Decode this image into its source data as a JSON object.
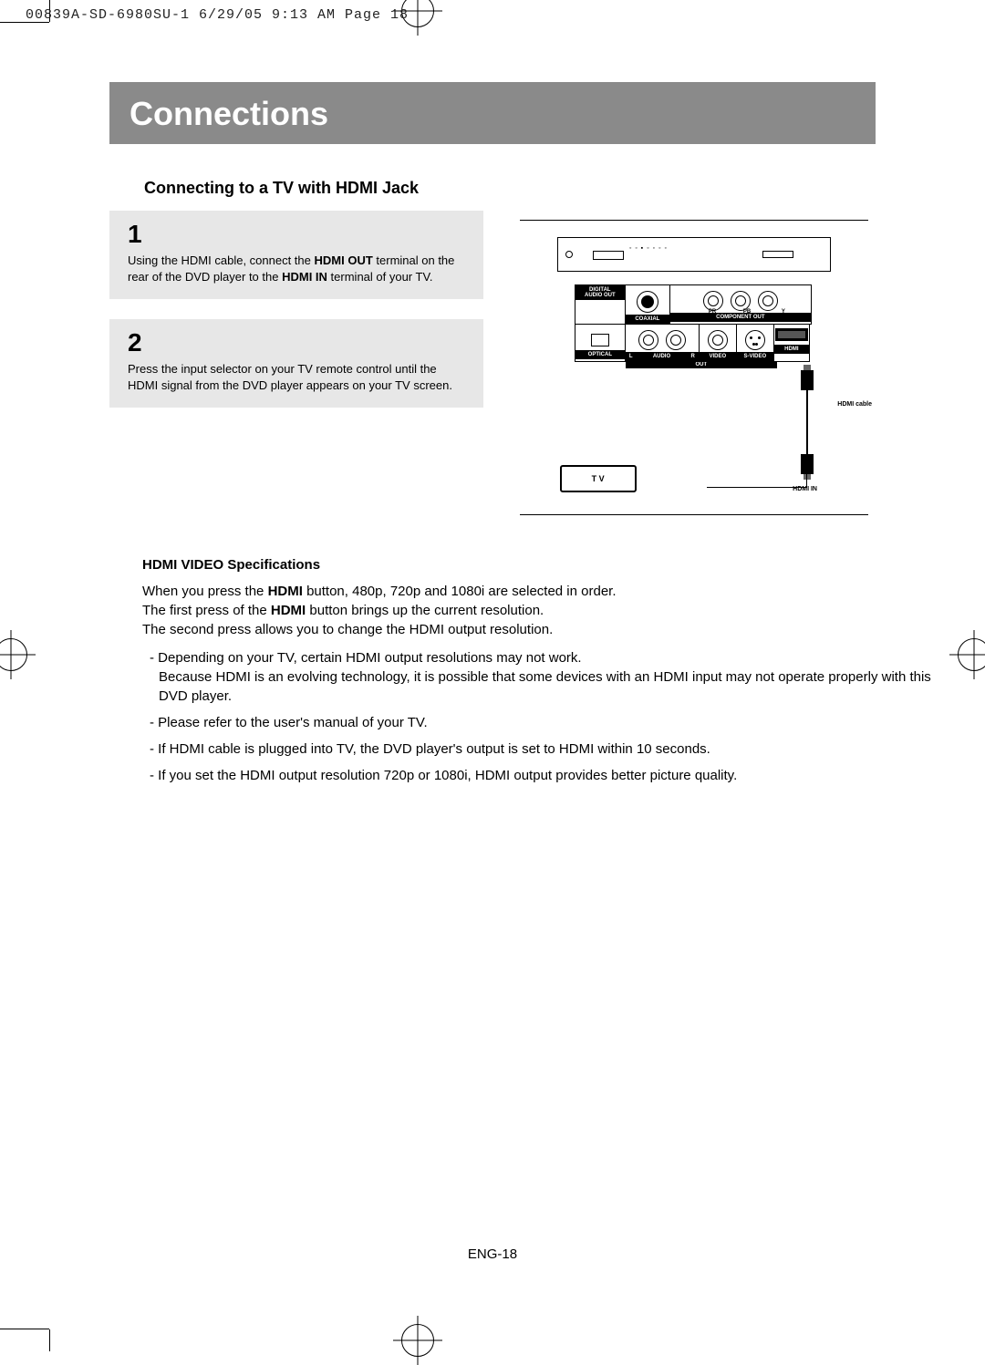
{
  "print_header": "00839A-SD-6980SU-1  6/29/05  9:13 AM  Page 18",
  "banner_title": "Connections",
  "subheading": "Connecting to a TV with HDMI Jack",
  "steps": [
    {
      "num": "1",
      "text_before": "Using the HDMI cable, connect the ",
      "bold1": "HDMI OUT",
      "text_mid1": " terminal on the rear of the DVD player to the ",
      "bold2": "HDMI IN",
      "text_after": " terminal of your TV."
    },
    {
      "num": "2",
      "text_before": "Press the input selector on your TV remote control until the HDMI signal from the DVD player appears on your TV screen.",
      "bold1": "",
      "text_mid1": "",
      "bold2": "",
      "text_after": ""
    }
  ],
  "diagram": {
    "ports": {
      "digital_audio_out": "DIGITAL\nAUDIO OUT",
      "coaxial": "COAXIAL",
      "component_out": "COMPONENT OUT",
      "comp_pr": "PR",
      "comp_pb": "PB",
      "comp_y": "Y",
      "optical": "OPTICAL",
      "audio": "AUDIO",
      "audio_l": "L",
      "audio_r": "R",
      "video": "VIDEO",
      "svideo": "S-VIDEO",
      "hdmi": "HDMI",
      "out_strip": "OUT"
    },
    "hdmi_cable": "HDMI cable",
    "hdmi_in": "HDMI IN",
    "tv": "T V"
  },
  "spec": {
    "title": "HDMI VIDEO Specifications",
    "para_parts": {
      "p1a": "When you press the ",
      "p1b": "HDMI",
      "p1c": " button, 480p, 720p and 1080i are selected in order.",
      "p2a": "The first press of the ",
      "p2b": "HDMI",
      "p2c": " button brings up the current resolution.",
      "p3": "The second press allows you to change the HDMI output resolution."
    },
    "items": [
      {
        "l1": "Depending on your TV, certain HDMI output resolutions may not work.",
        "l2": "Because HDMI is an evolving technology, it is possible that some devices with an HDMI input may not operate properly with this DVD player."
      },
      {
        "l1": "Please refer to the user's manual of your TV."
      },
      {
        "l1": "If HDMI cable is plugged into TV, the DVD player's output is set to HDMI within 10 seconds."
      },
      {
        "l1": "If you set the HDMI output resolution 720p or 1080i, HDMI output provides better picture quality."
      }
    ]
  },
  "footer": "ENG-18"
}
